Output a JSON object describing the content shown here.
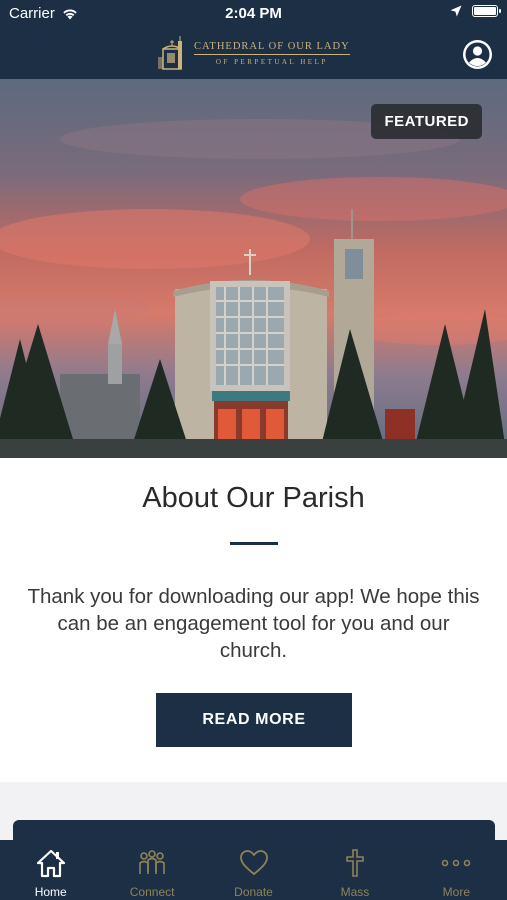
{
  "status_bar": {
    "carrier": "Carrier",
    "time": "2:04 PM"
  },
  "header": {
    "logo_line1": "CATHEDRAL OF OUR LADY",
    "logo_line2": "OF PERPETUAL HELP"
  },
  "hero": {
    "badge": "FEATURED"
  },
  "card": {
    "title": "About Our Parish",
    "text": "Thank you for downloading our app! We hope this can be an engagement tool for you and our church.",
    "button_label": "READ MORE"
  },
  "tabs": [
    {
      "label": "Home",
      "icon": "home-icon",
      "active": true
    },
    {
      "label": "Connect",
      "icon": "people-icon",
      "active": false
    },
    {
      "label": "Donate",
      "icon": "heart-icon",
      "active": false
    },
    {
      "label": "Mass",
      "icon": "cross-icon",
      "active": false
    },
    {
      "label": "More",
      "icon": "more-icon",
      "active": false
    }
  ],
  "colors": {
    "navy": "#1c2f45",
    "gold": "#c9b47c",
    "tab_inactive": "#8f8359"
  }
}
